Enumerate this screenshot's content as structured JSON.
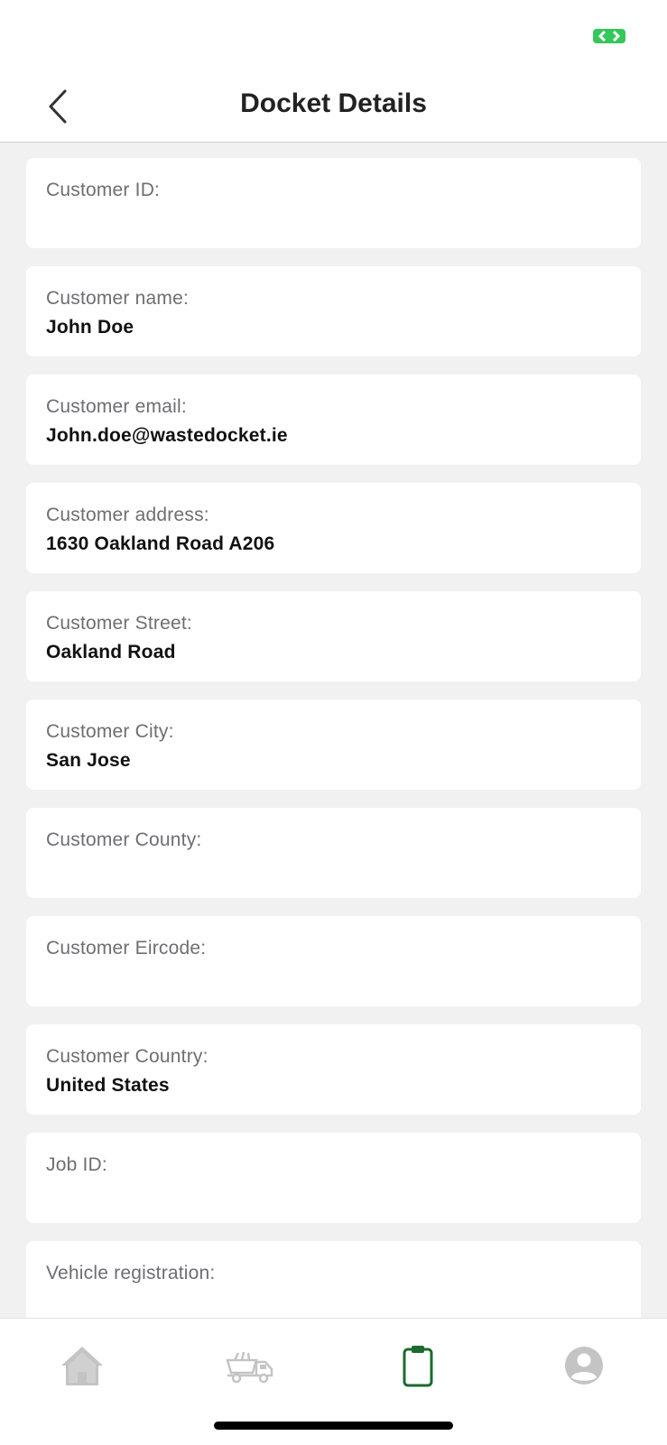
{
  "header": {
    "title": "Docket Details",
    "back_icon": "chevron-left-icon"
  },
  "status_bar": {
    "indicator_icon": "screen-record-icon",
    "indicator_color": "#34c759"
  },
  "fields": [
    {
      "label": "Customer ID:",
      "value": ""
    },
    {
      "label": "Customer name:",
      "value": "John Doe"
    },
    {
      "label": "Customer email:",
      "value": "John.doe@wastedocket.ie"
    },
    {
      "label": "Customer address:",
      "value": "1630 Oakland Road A206"
    },
    {
      "label": "Customer Street:",
      "value": "Oakland Road"
    },
    {
      "label": "Customer City:",
      "value": "San Jose"
    },
    {
      "label": "Customer County:",
      "value": ""
    },
    {
      "label": "Customer Eircode:",
      "value": ""
    },
    {
      "label": "Customer Country:",
      "value": "United States"
    },
    {
      "label": "Job ID:",
      "value": ""
    },
    {
      "label": "Vehicle registration:",
      "value": ""
    }
  ],
  "tab_bar": {
    "tabs": [
      {
        "icon": "home-icon",
        "active": false
      },
      {
        "icon": "skip-truck-icon",
        "active": false
      },
      {
        "icon": "clipboard-icon",
        "active": true
      },
      {
        "icon": "profile-icon",
        "active": false
      }
    ],
    "active_color": "#1b6b2e",
    "inactive_color": "#c4c4c4"
  }
}
